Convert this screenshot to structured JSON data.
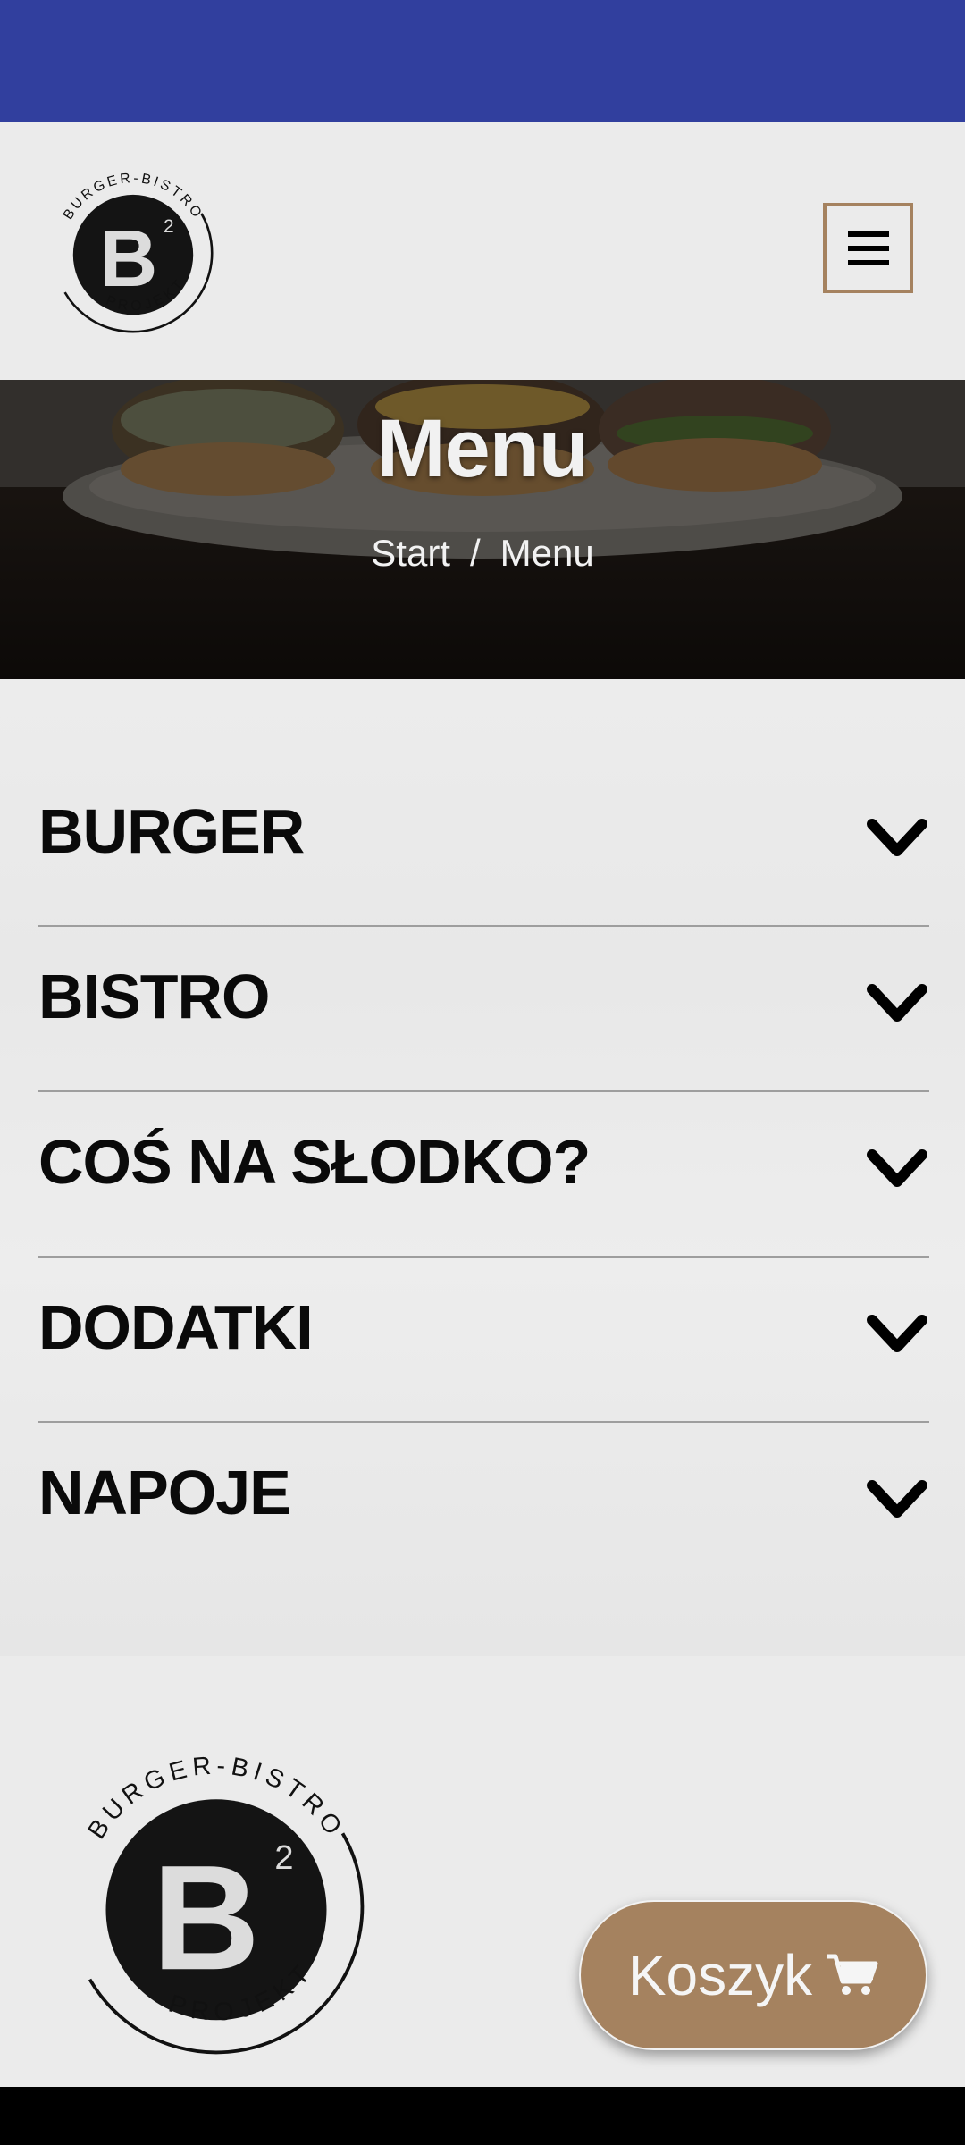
{
  "brand": {
    "top_text": "BURGER-BISTRO",
    "bottom_text": "PROJEKT",
    "letter": "B",
    "superscript": "2"
  },
  "header": {
    "menu_icon": "hamburger-menu-icon"
  },
  "hero": {
    "title": "Menu",
    "breadcrumb": {
      "home": "Start",
      "separator": "/",
      "current": "Menu"
    }
  },
  "categories": [
    {
      "label": "BURGER"
    },
    {
      "label": "BISTRO"
    },
    {
      "label": "COŚ NA SŁODKO?"
    },
    {
      "label": "DODATKI"
    },
    {
      "label": "NAPOJE"
    }
  ],
  "cart": {
    "label": "Koszyk",
    "icon": "shopping-cart-icon"
  },
  "colors": {
    "status_bar": "#313f9e",
    "accent": "#a5825f",
    "background": "#ebebeb",
    "text": "#0a0a0a"
  }
}
